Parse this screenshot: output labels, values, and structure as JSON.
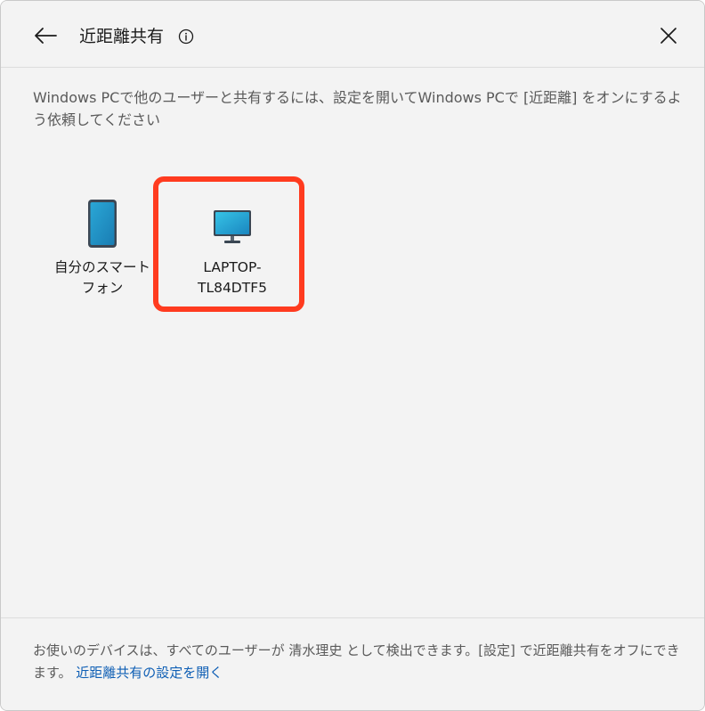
{
  "header": {
    "title": "近距離共有",
    "back_icon": "arrow-left-icon",
    "info_icon": "info-icon",
    "close_icon": "close-icon"
  },
  "instructions": "Windows PCで他のユーザーと共有するには、設定を開いてWindows PCで [近距離] をオンにするよう依頼してください",
  "devices": [
    {
      "label_line1": "自分のスマート",
      "label_line2": "フォン",
      "icon": "smartphone-icon"
    },
    {
      "label_line1": "LAPTOP-",
      "label_line2": "TL84DTF5",
      "icon": "monitor-icon"
    }
  ],
  "footer": {
    "text": "お使いのデバイスは、すべてのユーザーが 清水理史 として検出できます。[設定] で近距離共有をオフにできます。",
    "link": "近距離共有の設定を開く"
  },
  "colors": {
    "highlight": "#ff3b1f",
    "link": "#0f5fb5",
    "background": "#f3f3f3"
  }
}
